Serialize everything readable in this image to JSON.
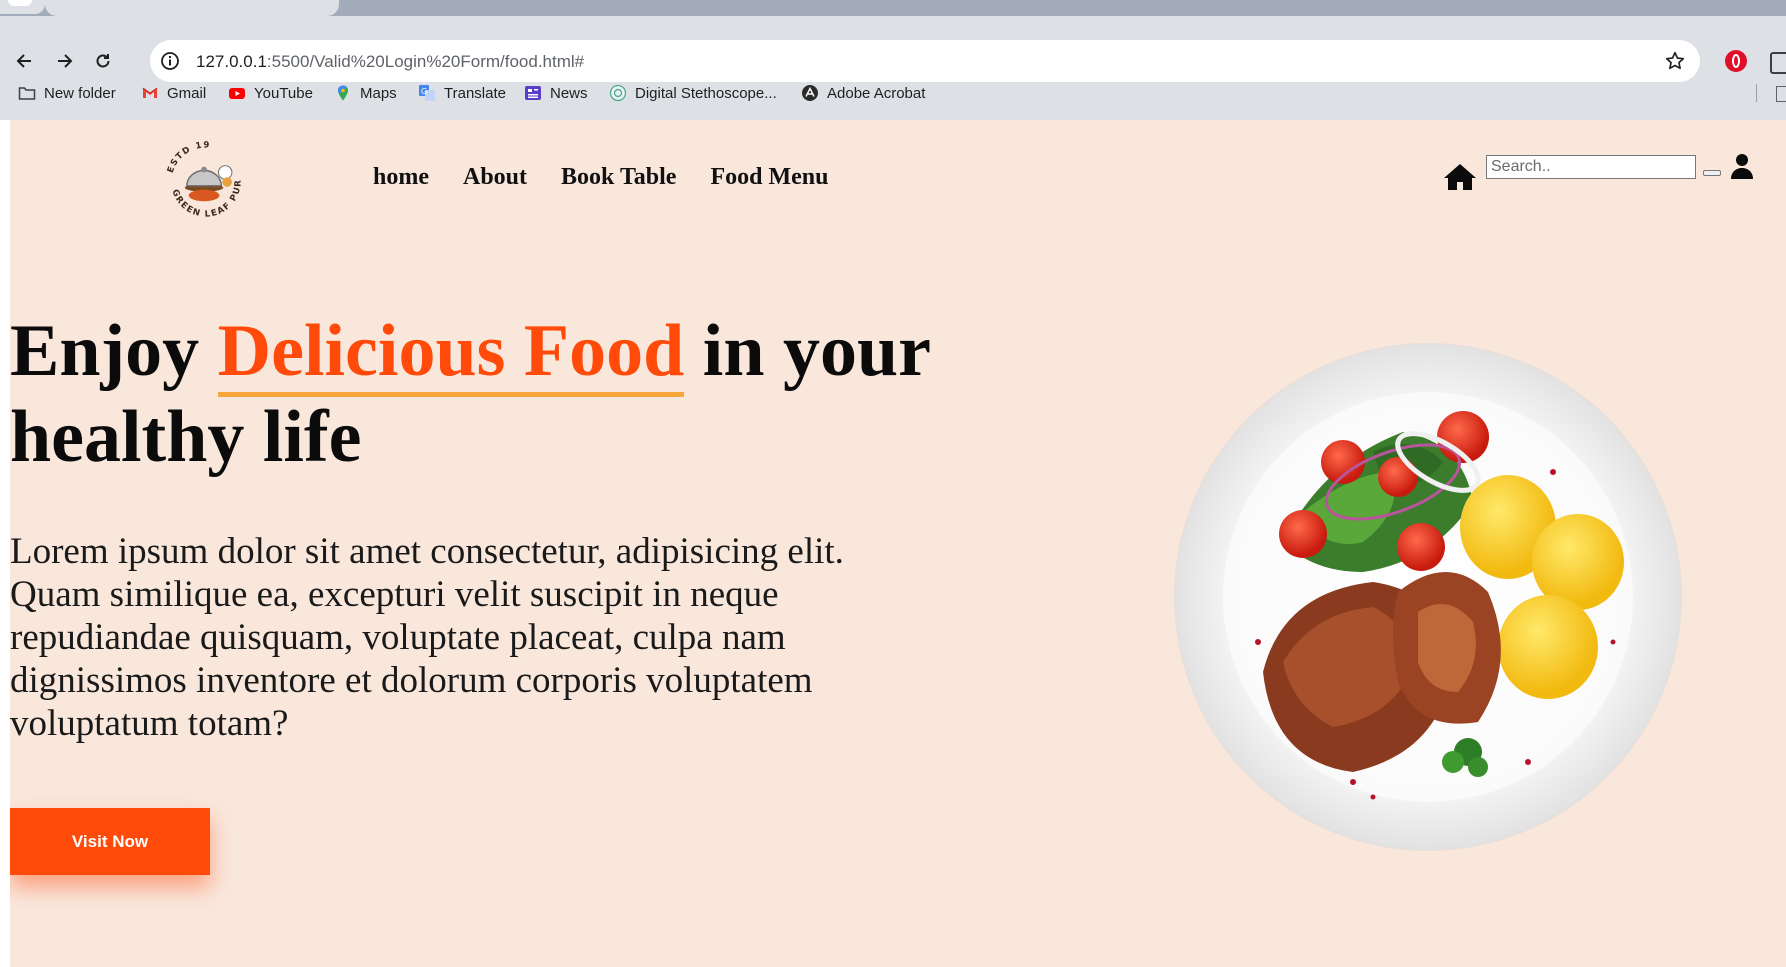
{
  "browser": {
    "url_host": "127.0.0.1",
    "url_path": ":5500/Valid%20Login%20Form/food.html#",
    "bookmarks": [
      {
        "label": "New folder",
        "icon": "folder-icon"
      },
      {
        "label": "Gmail",
        "icon": "gmail-icon"
      },
      {
        "label": "YouTube",
        "icon": "youtube-icon"
      },
      {
        "label": "Maps",
        "icon": "maps-icon"
      },
      {
        "label": "Translate",
        "icon": "translate-icon"
      },
      {
        "label": "News",
        "icon": "news-icon"
      },
      {
        "label": "Digital Stethoscope...",
        "icon": "stethoscope-icon"
      },
      {
        "label": "Adobe Acrobat",
        "icon": "acrobat-icon"
      }
    ]
  },
  "header": {
    "logo": {
      "top_text": "ESTD 19",
      "brand_text": "GREEN LEAF PURE VEG",
      "icon": "cloche-logo"
    },
    "nav": [
      "home",
      "About",
      "Book Table",
      "Food Menu"
    ],
    "search_placeholder": "Search..",
    "icons": [
      "home-icon",
      "user-icon"
    ]
  },
  "hero": {
    "title_pre": "Enjoy ",
    "title_highlight": "Delicious Food",
    "title_post": " in your healthy life",
    "body": "Lorem ipsum dolor sit amet consectetur, adipisicing elit. Quam similique ea, excepturi velit suscipit in neque repudiandae quisquam, voluptate placeat, culpa nam dignissimos inventore et dolorum corporis voluptatem voluptatum totam?",
    "button_label": "Visit Now",
    "image": "food-plate-image"
  },
  "colors": {
    "page_bg": "#f9e7dc",
    "accent": "#ff4a0a",
    "underline": "#f7a739"
  }
}
